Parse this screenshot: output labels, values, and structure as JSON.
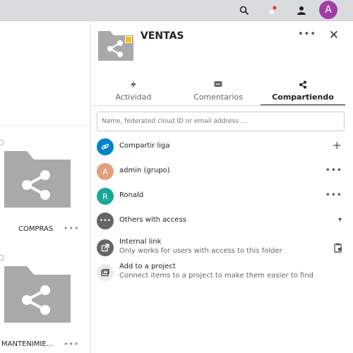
{
  "topbar": {
    "search_icon": "search-icon",
    "notifications_icon": "notifications-icon",
    "contacts_icon": "contacts-icon",
    "avatar_initial": "A",
    "avatar_color": "#a13ca4"
  },
  "files": [
    {
      "name": "COMPRAS",
      "menu": "•••"
    },
    {
      "name": "MANTENIMIE...",
      "menu": "•••"
    }
  ],
  "sidebar": {
    "title": "VENTAS",
    "menu": "•••",
    "close": "✕",
    "tabs": [
      {
        "label": "Actividad",
        "icon": "activity-icon"
      },
      {
        "label": "Comentarios",
        "icon": "comment-icon"
      },
      {
        "label": "Compartiendo",
        "icon": "share-icon"
      }
    ],
    "share_input_placeholder": "Name, federated cloud ID or email address ...",
    "rows": [
      {
        "label": "Compartir liga",
        "action": "+",
        "avatar": "",
        "color": "#0082c9"
      },
      {
        "label": "admin (grupo)",
        "action": "•••",
        "avatar": "A",
        "color": "#e0a07c"
      },
      {
        "label": "Ronald",
        "action": "•••",
        "avatar": "R",
        "color": "#1aa59a"
      },
      {
        "label": "Others with access",
        "action": "▾",
        "avatar": "•••",
        "color": "#666666"
      }
    ],
    "internal_link": {
      "title": "Internal link",
      "subtitle": "Only works for users with access to this folder"
    },
    "project": {
      "title": "Add to a project",
      "subtitle": "Connect items to a project to make them easier to find"
    }
  }
}
